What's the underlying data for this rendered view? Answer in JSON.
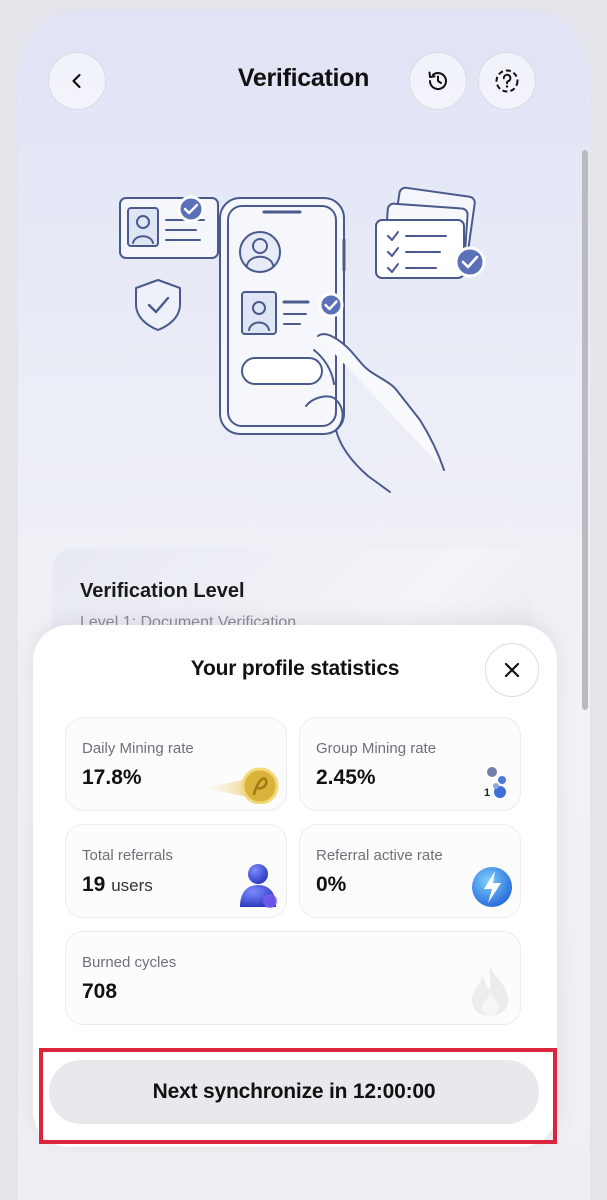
{
  "header": {
    "title": "Verification",
    "back_icon": "chevron-left-icon",
    "history_icon": "history-icon",
    "help_icon": "help-circle-icon"
  },
  "verification_card": {
    "title": "Verification Level",
    "subtitle": "Level 1: Document Verification"
  },
  "stats_sheet": {
    "title": "Your profile statistics",
    "close_icon": "close-icon",
    "stats": [
      {
        "label": "Daily Mining rate",
        "value": "17.8%",
        "unit": "",
        "icon": "coin-icon"
      },
      {
        "label": "Group Mining rate",
        "value": "2.45%",
        "unit": "",
        "icon": "group-nodes-icon"
      },
      {
        "label": "Total referrals",
        "value": "19",
        "unit": "users",
        "icon": "user-icon"
      },
      {
        "label": "Referral active rate",
        "value": "0%",
        "unit": "",
        "icon": "lightning-icon"
      },
      {
        "label": "Burned cycles",
        "value": "708",
        "unit": "",
        "icon": "flame-icon"
      }
    ],
    "group_badge": "1",
    "sync_button": "Next synchronize in 12:00:00"
  },
  "colors": {
    "highlight": "#d9263c",
    "accent_blue": "#5a70b8"
  }
}
